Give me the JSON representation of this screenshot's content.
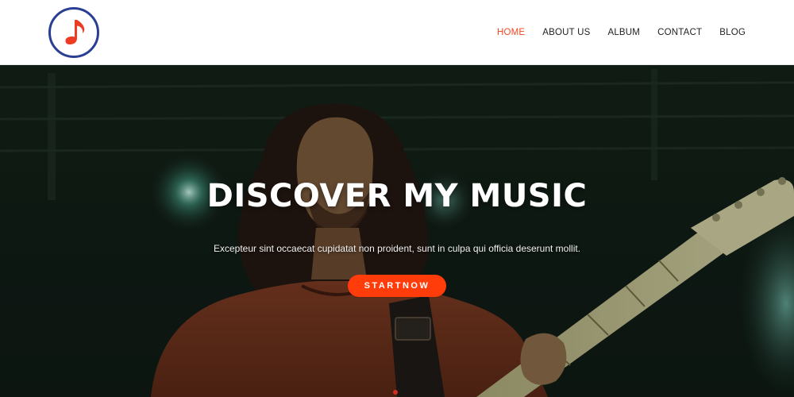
{
  "brand": {
    "logo_icon": "music-note-icon",
    "ring_color": "#2a3f93",
    "note_color": "#ee3b24"
  },
  "nav": {
    "items": [
      {
        "label": "HOME",
        "active": true
      },
      {
        "label": "ABOUT US",
        "active": false
      },
      {
        "label": "ALBUM",
        "active": false
      },
      {
        "label": "CONTACT",
        "active": false
      },
      {
        "label": "BLOG",
        "active": false
      }
    ],
    "active_color": "#f04a23"
  },
  "hero": {
    "title": "DISCOVER MY MUSIC",
    "subtitle": "Excepteur sint occaecat cupidatat non proident, sunt in culpa qui officia deserunt mollit.",
    "cta_label": "STARTNOW",
    "cta_color": "#ff3c0a",
    "image": "guitarist-on-stage-photo"
  }
}
